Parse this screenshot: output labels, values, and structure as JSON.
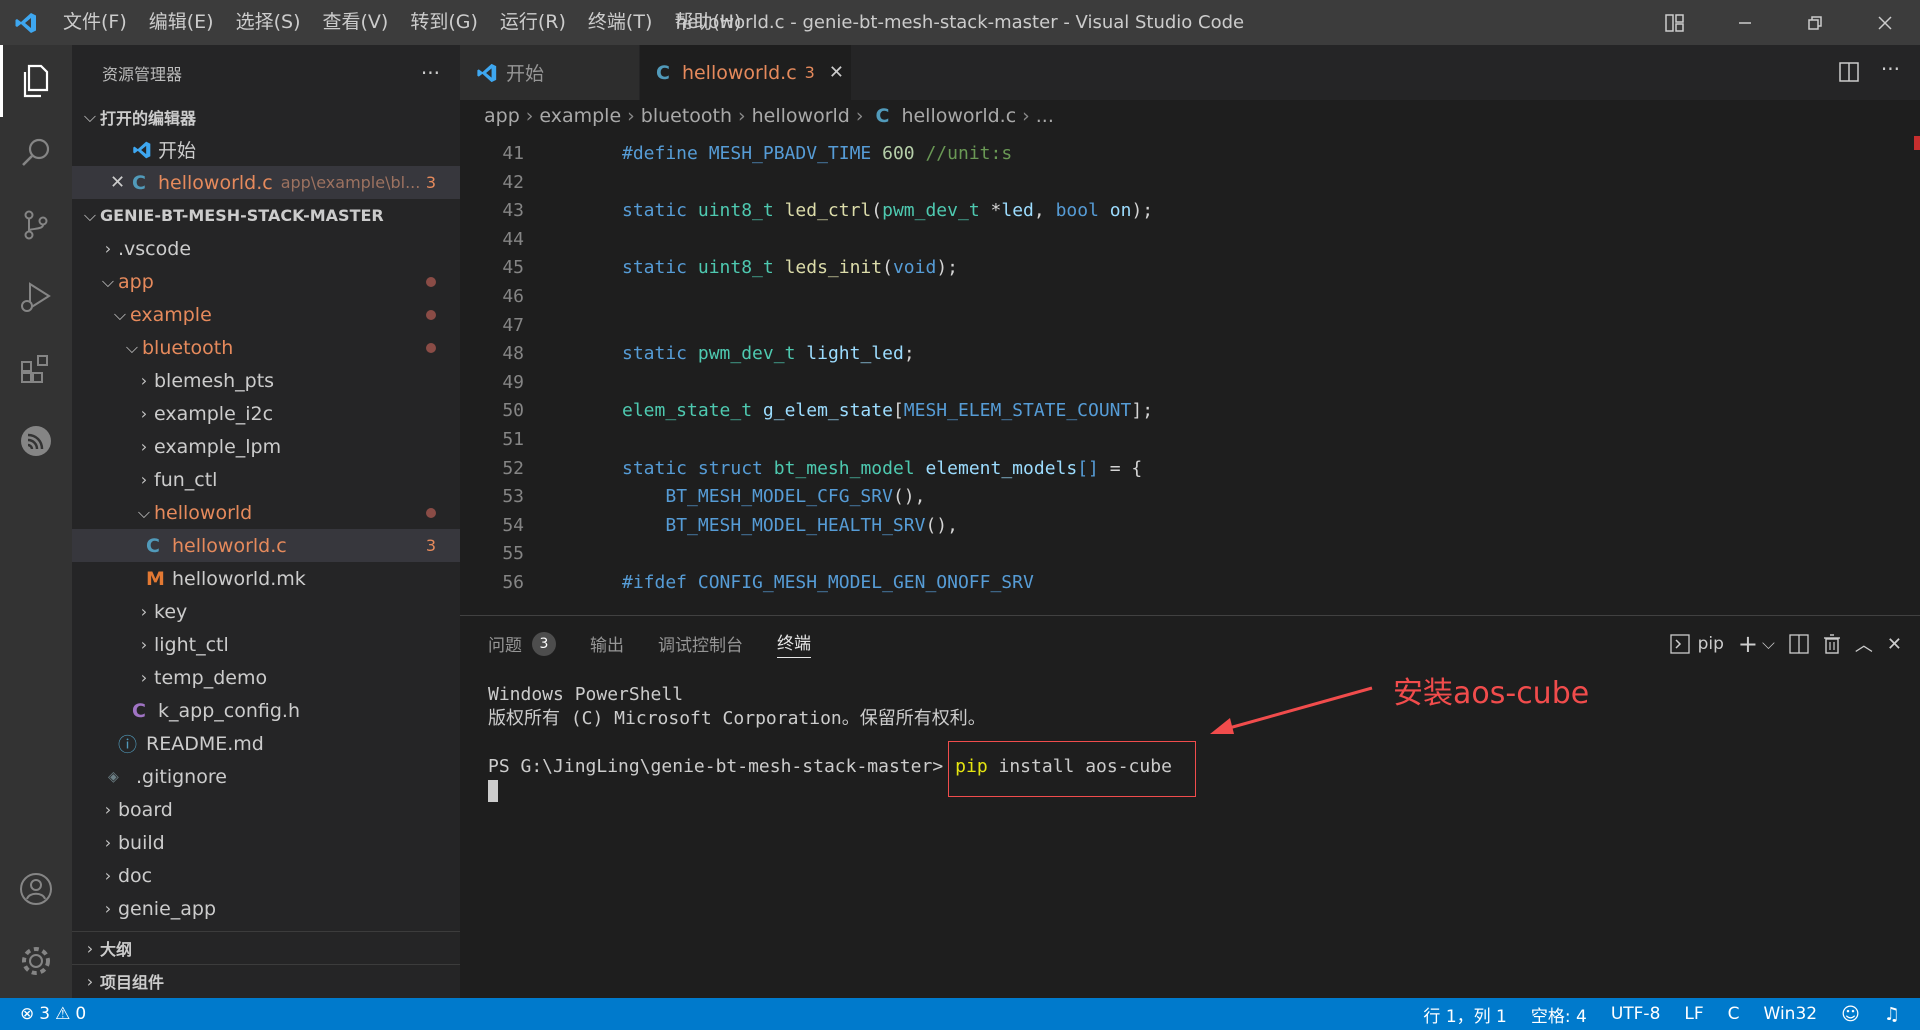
{
  "title_bar": {
    "menus": [
      "文件(F)",
      "编辑(E)",
      "选择(S)",
      "查看(V)",
      "转到(G)",
      "运行(R)",
      "终端(T)",
      "帮助(H)"
    ],
    "window_title": "helloworld.c - genie-bt-mesh-stack-master - Visual Studio Code"
  },
  "activity_bar": [
    "files-icon",
    "search-icon",
    "source-control-icon",
    "run-debug-icon",
    "extensions-icon",
    "espressif-icon",
    "account-icon",
    "settings-gear-icon"
  ],
  "sidebar": {
    "header": "资源管理器",
    "more": "···",
    "open_editors_title": "打开的编辑器",
    "open_editors": [
      {
        "name": "开始"
      },
      {
        "name": "helloworld.c",
        "path": "app\\example\\bl...",
        "problems": "3"
      }
    ],
    "project_title": "GENIE-BT-MESH-STACK-MASTER",
    "tree": [
      {
        "name": ".vscode"
      },
      {
        "name": "app"
      },
      {
        "name": "example"
      },
      {
        "name": "bluetooth"
      },
      {
        "name": "blemesh_pts"
      },
      {
        "name": "example_i2c"
      },
      {
        "name": "example_lpm"
      },
      {
        "name": "fun_ctl"
      },
      {
        "name": "helloworld"
      },
      {
        "name": "helloworld.c",
        "problems": "3"
      },
      {
        "name": "helloworld.mk"
      },
      {
        "name": "key"
      },
      {
        "name": "light_ctl"
      },
      {
        "name": "temp_demo"
      },
      {
        "name": "k_app_config.h"
      },
      {
        "name": "README.md"
      },
      {
        "name": ".gitignore"
      },
      {
        "name": "board"
      },
      {
        "name": "build"
      },
      {
        "name": "doc"
      },
      {
        "name": "genie_app"
      }
    ],
    "outline_title": "大纲",
    "components_title": "项目组件"
  },
  "tabs": [
    {
      "label": "开始"
    },
    {
      "label": "helloworld.c",
      "problems": "3"
    }
  ],
  "breadcrumb": [
    "app",
    "example",
    "bluetooth",
    "helloworld",
    "helloworld.c",
    "..."
  ],
  "code": {
    "line_numbers": [
      "41",
      "42",
      "43",
      "44",
      "45",
      "46",
      "47",
      "48",
      "49",
      "50",
      "51",
      "52",
      "53",
      "54",
      "55",
      "56"
    ]
  },
  "panel": {
    "tabs": [
      {
        "label": "问题",
        "badge": "3"
      },
      {
        "label": "输出"
      },
      {
        "label": "调试控制台"
      },
      {
        "label": "终端"
      }
    ],
    "terminal_name": "pip",
    "terminal_lines": [
      "Windows PowerShell",
      "版权所有 (C) Microsoft Corporation。保留所有权利。",
      ""
    ],
    "prompt": "PS G:\\JingLing\\genie-bt-mesh-stack-master>",
    "cmd_word": "pip",
    "cmd_rest": " install aos-cube"
  },
  "annotation": {
    "text": "安装aos-cube",
    "color": "#f14c4c"
  },
  "status_bar": {
    "errors": "3",
    "warnings": "0",
    "position": "行 1，列 1",
    "spaces": "空格: 4",
    "encoding": "UTF-8",
    "eol": "LF",
    "language": "C",
    "platform": "Win32",
    "background": "#007acc"
  }
}
